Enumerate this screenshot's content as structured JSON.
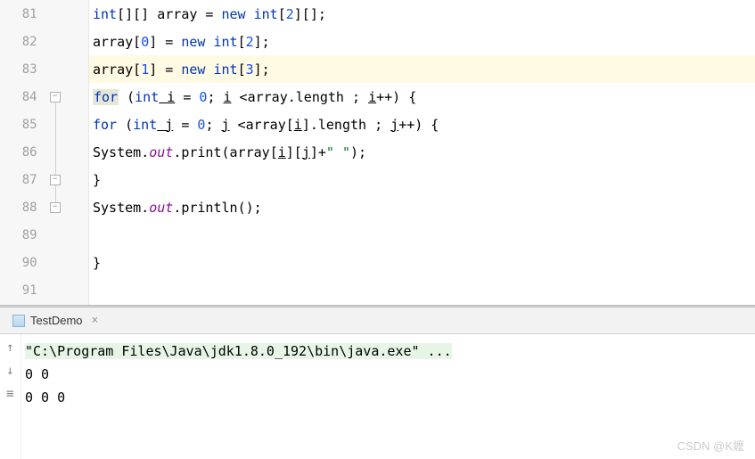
{
  "editor": {
    "lines": [
      {
        "num": "81",
        "fold": "none"
      },
      {
        "num": "82",
        "fold": "none"
      },
      {
        "num": "83",
        "fold": "none",
        "highlight": true
      },
      {
        "num": "84",
        "fold": "open"
      },
      {
        "num": "85",
        "fold": "line"
      },
      {
        "num": "86",
        "fold": "line"
      },
      {
        "num": "87",
        "fold": "close-inner"
      },
      {
        "num": "88",
        "fold": "close"
      },
      {
        "num": "89",
        "fold": "none"
      },
      {
        "num": "90",
        "fold": "none"
      },
      {
        "num": "91",
        "fold": "none"
      }
    ],
    "code": {
      "l81": {
        "kw_int": "int",
        "sq": "[][] ",
        "var": "array",
        "eq": " = ",
        "kw_new": "new",
        "sp": " ",
        "kw_int2": "int",
        "lb": "[",
        "n": "2",
        "rb": "][];"
      },
      "l82": {
        "var": "array",
        "lb": "[",
        "n": "0",
        "rb": "] = ",
        "kw_new": "new",
        "sp": " ",
        "kw_int": "int",
        "lb2": "[",
        "n2": "2",
        "rb2": "];"
      },
      "l83": {
        "var": "array",
        "lb": "[",
        "n": "1",
        "rb": "] = ",
        "kw_new": "new",
        "sp": " ",
        "kw_int": "int",
        "lb2": "[",
        "n2": "3",
        "rb2": "];"
      },
      "l84": {
        "kw_for": "for",
        "sp": " (",
        "kw_int": "int",
        "i": " i",
        "eq": " = ",
        "z": "0",
        "semi": "; ",
        "i2": "i",
        "cmp": " <",
        "arr": "array",
        "dot": ".",
        "len": "length",
        "sp2": " ; ",
        "i3": "i",
        "inc": "++) {"
      },
      "l85": {
        "kw_for": "for",
        "sp": " (",
        "kw_int": "int",
        "j": " j",
        "eq": " = ",
        "z": "0",
        "semi": "; ",
        "j2": "j",
        "cmp": " <",
        "arr": "array",
        "lb": "[",
        "i": "i",
        "rb": "].",
        "len": "length",
        "sp2": " ; ",
        "j3": "j",
        "inc": "++) {"
      },
      "l86": {
        "sys": "System",
        "dot": ".",
        "out": "out",
        "dot2": ".",
        "print": "print",
        "paren": "(",
        "arr": "array",
        "lb": "[",
        "i": "i",
        "rb": "][",
        "j": "j",
        "rb2": "]+",
        "str": "\" \"",
        "end": ");"
      },
      "l87": {
        "brace": "}"
      },
      "l88": {
        "sys": "System",
        "dot": ".",
        "out": "out",
        "dot2": ".",
        "println": "println",
        "paren": "();"
      },
      "l90": {
        "brace": "}"
      }
    }
  },
  "tab": {
    "label": "TestDemo",
    "close": "×"
  },
  "console": {
    "icons": {
      "up": "↑",
      "down": "↓",
      "wrap": "↲"
    },
    "cmd": "\"C:\\Program Files\\Java\\jdk1.8.0_192\\bin\\java.exe\" ...",
    "out1": "0 0",
    "out2": "0 0 0"
  },
  "watermark": "CSDN @K嬷"
}
